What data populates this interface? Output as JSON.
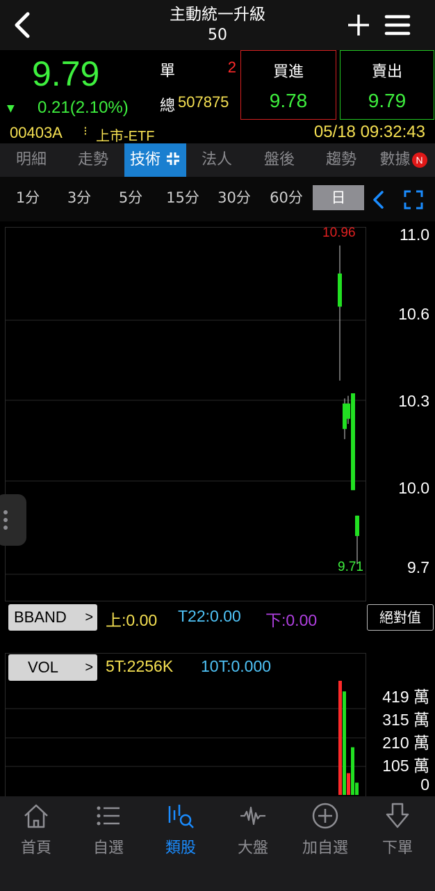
{
  "header": {
    "title": "主動統一升級",
    "subtitle": "50"
  },
  "quote": {
    "price": "9.79",
    "change": "0.21(2.10%)",
    "single_label": "單",
    "single_value": "2",
    "total_label": "總",
    "total_value": "507875",
    "buy_label": "買進",
    "buy_price": "9.78",
    "sell_label": "賣出",
    "sell_price": "9.79",
    "code": "00403A",
    "market": "上市-ETF",
    "datetime": "05/18 09:32:43"
  },
  "tabs": [
    {
      "label": "明細"
    },
    {
      "label": "走勢"
    },
    {
      "label": "技術"
    },
    {
      "label": "法人"
    },
    {
      "label": "盤後"
    },
    {
      "label": "趨勢"
    },
    {
      "label": "數據"
    }
  ],
  "tab_badge": "N",
  "periods": [
    "1分",
    "3分",
    "5分",
    "15分",
    "30分",
    "60分",
    "日"
  ],
  "active_period": "日",
  "chart": {
    "high_label": "10.96",
    "low_label": "9.71",
    "y_labels": [
      "11.0",
      "10.6",
      "10.3",
      "10.0",
      "9.7"
    ],
    "candles": [
      {
        "open": 10.85,
        "close": 10.72,
        "high": 10.96,
        "low": 10.43,
        "color": "green"
      },
      {
        "open": 10.24,
        "close": 10.34,
        "high": 10.36,
        "low": 10.2,
        "color": "green"
      },
      {
        "open": 10.34,
        "close": 10.28,
        "high": 10.37,
        "low": 10.26,
        "color": "green"
      },
      {
        "open": 10.38,
        "close": 10.0,
        "high": 10.38,
        "low": 10.0,
        "color": "green"
      },
      {
        "open": 9.9,
        "close": 9.82,
        "high": 9.9,
        "low": 9.71,
        "color": "green"
      }
    ],
    "colors": {
      "up": "#ff2a2a",
      "down": "#22e022",
      "grid": "#2a2a2a"
    }
  },
  "bband": {
    "button": "BBAND",
    "upper": "上:0.00",
    "mid": "T22:0.00",
    "lower": "下:0.00",
    "abs_button": "絕對值"
  },
  "vol": {
    "button": "VOL",
    "t5": "5T:2256K",
    "t10": "10T:0.000",
    "y_labels": [
      "419 萬",
      "315 萬",
      "210 萬",
      "105 萬",
      "0"
    ],
    "bars_wan": [
      419,
      380,
      80,
      175,
      45
    ]
  },
  "bottom_nav": [
    {
      "label": "首頁"
    },
    {
      "label": "自選"
    },
    {
      "label": "類股"
    },
    {
      "label": "大盤"
    },
    {
      "label": "加自選"
    },
    {
      "label": "下單"
    }
  ]
}
